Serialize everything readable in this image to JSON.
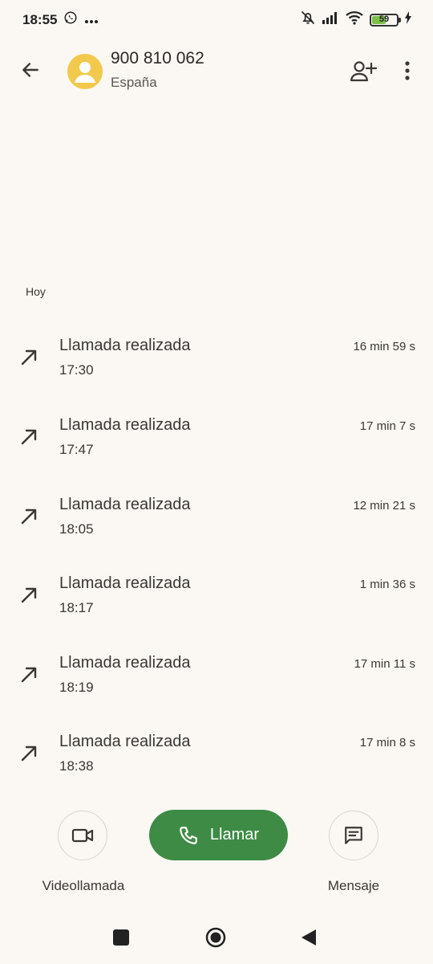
{
  "status_bar": {
    "time": "18:55",
    "icons_left": [
      "whatsapp-icon",
      "more-notifications-icon"
    ],
    "icons_right": [
      "silent-bell-icon",
      "signal-icon",
      "wifi-icon",
      "battery-icon",
      "charging-icon"
    ],
    "battery_level": "59",
    "battery_fraction": 0.59
  },
  "header": {
    "name": "900 810 062",
    "subtitle": "España"
  },
  "section": {
    "label": "Hoy"
  },
  "calls": [
    {
      "title": "Llamada realizada",
      "time": "17:30",
      "duration": "16 min 59 s"
    },
    {
      "title": "Llamada realizada",
      "time": "17:47",
      "duration": "17 min 7 s"
    },
    {
      "title": "Llamada realizada",
      "time": "18:05",
      "duration": "12 min 21 s"
    },
    {
      "title": "Llamada realizada",
      "time": "18:17",
      "duration": "1 min 36 s"
    },
    {
      "title": "Llamada realizada",
      "time": "18:19",
      "duration": "17 min 11 s"
    },
    {
      "title": "Llamada realizada",
      "time": "18:38",
      "duration": "17 min 8 s"
    }
  ],
  "actions": {
    "video_label": "Videollamada",
    "call_label": "Llamar",
    "message_label": "Mensaje"
  },
  "colors": {
    "background": "#fbf8f3",
    "accent_green": "#3d8b45",
    "avatar_yellow": "#f2c94c",
    "battery_green": "#7cc04a"
  }
}
